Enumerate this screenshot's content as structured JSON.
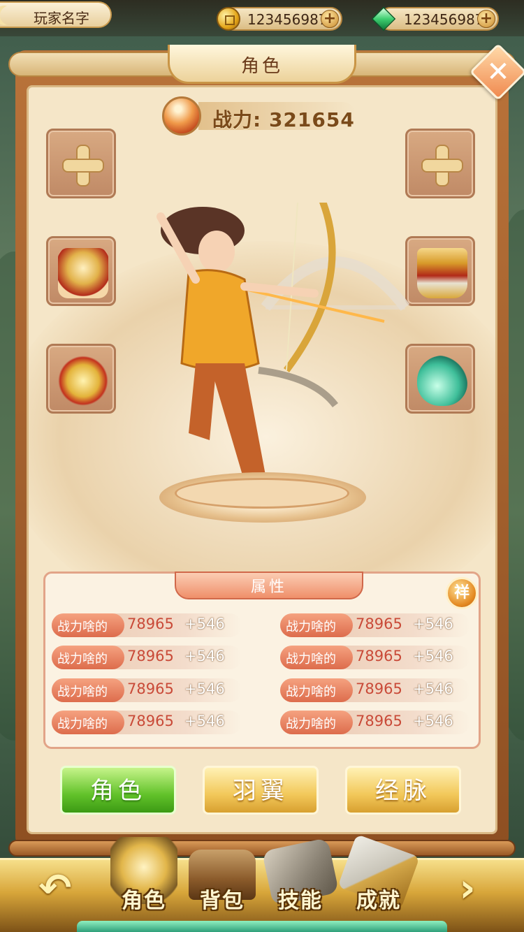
{
  "topbar": {
    "player_name": "玩家名字",
    "gold": {
      "icon": "gold-coin-icon",
      "amount": "123456987",
      "add_icon": "plus-icon"
    },
    "gem": {
      "icon": "green-gem-icon",
      "amount": "123456987",
      "add_icon": "plus-icon"
    }
  },
  "panel": {
    "title": "角色",
    "close_icon": "close-x-icon",
    "power_label": "战力: 321654",
    "detail_badge": "祥"
  },
  "equipment": {
    "left": [
      {
        "name": "empty-slot",
        "icon": "plus-icon"
      },
      {
        "name": "helmet",
        "icon": "helmet-icon"
      },
      {
        "name": "amulet",
        "icon": "amulet-icon"
      }
    ],
    "right": [
      {
        "name": "empty-slot",
        "icon": "plus-icon"
      },
      {
        "name": "armor",
        "icon": "armor-icon"
      },
      {
        "name": "gourd",
        "icon": "gourd-icon"
      }
    ]
  },
  "attributes": {
    "title": "属性",
    "rows": [
      {
        "label": "战力啥的",
        "value": "78965",
        "bonus": "+546"
      },
      {
        "label": "战力啥的",
        "value": "78965",
        "bonus": "+546"
      },
      {
        "label": "战力啥的",
        "value": "78965",
        "bonus": "+546"
      },
      {
        "label": "战力啥的",
        "value": "78965",
        "bonus": "+546"
      },
      {
        "label": "战力啥的",
        "value": "78965",
        "bonus": "+546"
      },
      {
        "label": "战力啥的",
        "value": "78965",
        "bonus": "+546"
      },
      {
        "label": "战力啥的",
        "value": "78965",
        "bonus": "+546"
      },
      {
        "label": "战力啥的",
        "value": "78965",
        "bonus": "+546"
      }
    ]
  },
  "tabs": [
    {
      "label": "角色",
      "active": true
    },
    {
      "label": "羽翼",
      "active": false
    },
    {
      "label": "经脉",
      "active": false
    }
  ],
  "nav": {
    "back_icon": "back-arrow-icon",
    "next_icon": "next-arrow-icon",
    "items": [
      {
        "label": "角色",
        "icon": "helmet-icon"
      },
      {
        "label": "背包",
        "icon": "chest-icon"
      },
      {
        "label": "技能",
        "icon": "skill-book-icon"
      },
      {
        "label": "成就",
        "icon": "scroll-icon"
      }
    ]
  },
  "colors": {
    "accent_green": "#62c22a",
    "accent_gold": "#f2c85a",
    "attribute_red": "#c94a38"
  }
}
